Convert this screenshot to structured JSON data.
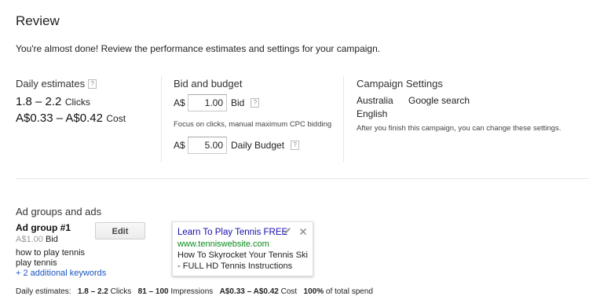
{
  "header": {
    "title": "Review",
    "intro": "You're almost done! Review the performance estimates and settings for your campaign."
  },
  "daily_estimates": {
    "heading": "Daily estimates",
    "help": "?",
    "clicks_range": "1.8 – 2.2",
    "clicks_label": "Clicks",
    "cost_range": "A$0.33 – A$0.42",
    "cost_label": "Cost"
  },
  "bid_budget": {
    "heading": "Bid and budget",
    "currency": "A$",
    "bid_value": "1.00",
    "bid_label": "Bid",
    "help": "?",
    "bid_note": "Focus on clicks, manual maximum CPC bidding",
    "budget_value": "5.00",
    "budget_label": "Daily Budget"
  },
  "campaign_settings": {
    "heading": "Campaign Settings",
    "location": "Australia",
    "network": "Google search",
    "language": "English",
    "note": "After you finish this campaign, you can change these settings."
  },
  "ad_groups": {
    "heading": "Ad groups and ads",
    "group_name": "Ad group #1",
    "group_bid": "A$1.00",
    "group_bid_label": "Bid",
    "keywords": [
      "how to play tennis",
      "play tennis"
    ],
    "more_keywords": "+ 2 additional keywords",
    "edit_label": "Edit"
  },
  "ad": {
    "headline": "Learn To Play Tennis FREE",
    "url": "www.tenniswebsite.com",
    "desc1": "How To Skyrocket Your Tennis Ski",
    "desc2": "- FULL HD Tennis Instructions"
  },
  "footer": {
    "label": "Daily estimates:",
    "clicks": "1.8 – 2.2",
    "clicks_label": "Clicks",
    "impressions": "81 – 100",
    "impressions_label": "Impressions",
    "cost": "A$0.33 – A$0.42",
    "cost_label": "Cost",
    "spend": "100%",
    "spend_label": "of total spend"
  },
  "icons": {
    "edit": "pencil-icon",
    "close": "close-icon",
    "help": "help-icon"
  }
}
